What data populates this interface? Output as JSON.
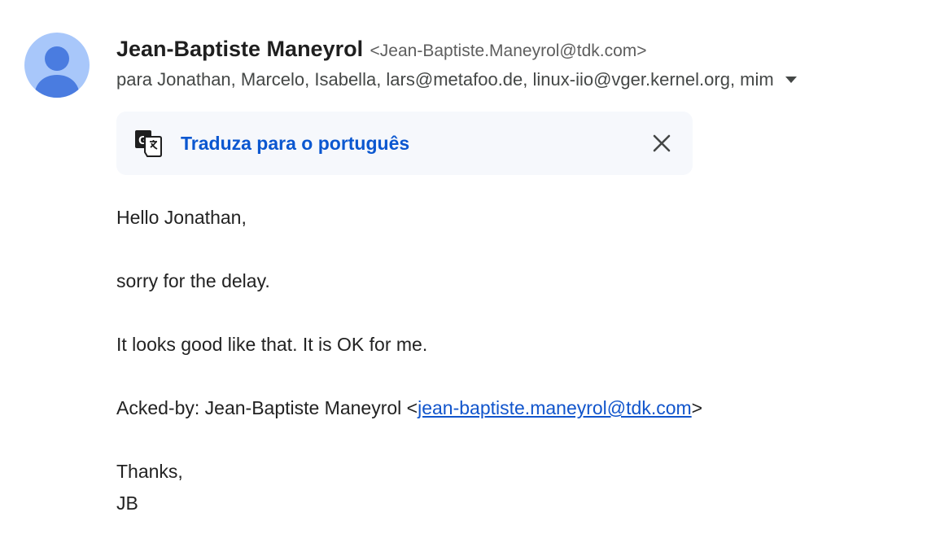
{
  "message": {
    "sender_name": "Jean-Baptiste Maneyrol",
    "sender_email": "<Jean-Baptiste.Maneyrol@tdk.com>",
    "recipients": "para Jonathan, Marcelo, Isabella, lars@metafoo.de, linux-iio@vger.kernel.org, mim",
    "avatar_icon": "person-icon",
    "avatar_color": "#a8c7fa"
  },
  "translate_bar": {
    "icon": "translate-icon",
    "label": "Traduza para o português",
    "close_icon": "close-icon"
  },
  "body": {
    "greeting": "Hello Jonathan,",
    "line1": "sorry for the delay.",
    "line2": "It looks good like that. It is OK for me.",
    "acked_prefix": "Acked-by: Jean-Baptiste Maneyrol <",
    "acked_link": "jean-baptiste.maneyrol@tdk.com",
    "acked_suffix": ">",
    "thanks": "Thanks,",
    "signature": "JB"
  },
  "colors": {
    "link": "#0b57d0",
    "text": "#1f1f1f",
    "secondary": "#444746",
    "translate_bg": "#f6f8fc"
  }
}
